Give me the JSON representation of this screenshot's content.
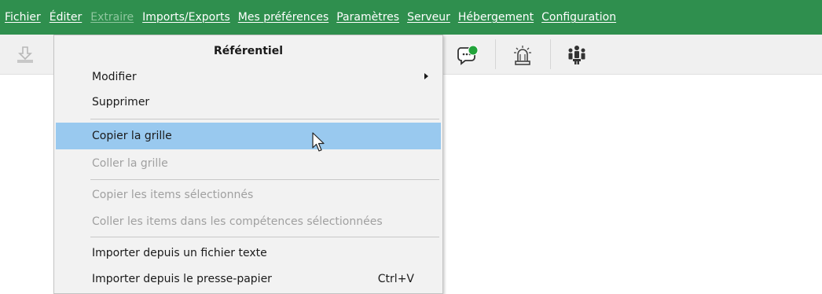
{
  "menubar": {
    "items": [
      {
        "label": "Fichier",
        "enabled": true
      },
      {
        "label": "Éditer",
        "enabled": true
      },
      {
        "label": "Extraire",
        "enabled": false
      },
      {
        "label": "Imports/Exports",
        "enabled": true
      },
      {
        "label": "Mes préférences",
        "enabled": true
      },
      {
        "label": "Paramètres",
        "enabled": true
      },
      {
        "label": "Serveur",
        "enabled": true
      },
      {
        "label": "Hébergement",
        "enabled": true
      },
      {
        "label": "Configuration",
        "enabled": true
      }
    ],
    "background": "#2f8f4e"
  },
  "toolbar": {
    "icons": [
      "download-icon",
      "chat-status-icon",
      "alarm-light-icon",
      "team-icon"
    ]
  },
  "dropdown": {
    "title": "Référentiel",
    "items": [
      {
        "label": "Modifier",
        "enabled": true,
        "submenu": true
      },
      {
        "label": "Supprimer",
        "enabled": true
      },
      {
        "label": "Copier la grille",
        "enabled": true,
        "highlighted": true
      },
      {
        "label": "Coller la grille",
        "enabled": false
      },
      {
        "label": "Copier les items sélectionnés",
        "enabled": false
      },
      {
        "label": "Coller les items dans les compétences sélectionnées",
        "enabled": false
      },
      {
        "label": "Importer depuis un fichier texte",
        "enabled": true
      },
      {
        "label": "Importer depuis le presse-papier",
        "enabled": true,
        "shortcut": "Ctrl+V"
      }
    ],
    "highlight_color": "#99c9ef"
  }
}
